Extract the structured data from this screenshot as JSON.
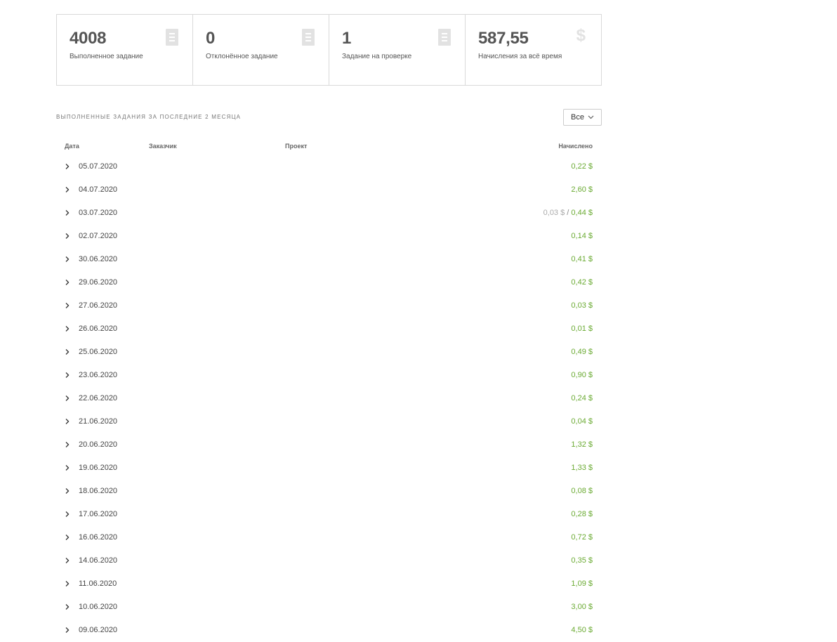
{
  "stats": [
    {
      "value": "4008",
      "label": "Выполненное задание",
      "icon": "document-icon"
    },
    {
      "value": "0",
      "label": "Отклонённое задание",
      "icon": "document-icon"
    },
    {
      "value": "1",
      "label": "Задание на проверке",
      "icon": "document-icon"
    },
    {
      "value": "587,55",
      "label": "Начисления за всё время",
      "icon": "dollar-icon"
    }
  ],
  "section_title": "Выполненные задания за последние 2 месяца",
  "filter": {
    "selected": "Все"
  },
  "table": {
    "headers": {
      "date": "Дата",
      "customer": "Заказчик",
      "project": "Проект",
      "amount": "Начислено"
    },
    "rows": [
      {
        "date": "05.07.2020",
        "amount": "0,22 $"
      },
      {
        "date": "04.07.2020",
        "amount": "2,60 $"
      },
      {
        "date": "03.07.2020",
        "pending": "0,03 $",
        "separator": " / ",
        "amount": "0,44 $"
      },
      {
        "date": "02.07.2020",
        "amount": "0,14 $"
      },
      {
        "date": "30.06.2020",
        "amount": "0,41 $"
      },
      {
        "date": "29.06.2020",
        "amount": "0,42 $"
      },
      {
        "date": "27.06.2020",
        "amount": "0,03 $"
      },
      {
        "date": "26.06.2020",
        "amount": "0,01 $"
      },
      {
        "date": "25.06.2020",
        "amount": "0,49 $"
      },
      {
        "date": "23.06.2020",
        "amount": "0,90 $"
      },
      {
        "date": "22.06.2020",
        "amount": "0,24 $"
      },
      {
        "date": "21.06.2020",
        "amount": "0,04 $"
      },
      {
        "date": "20.06.2020",
        "amount": "1,32 $"
      },
      {
        "date": "19.06.2020",
        "amount": "1,33 $"
      },
      {
        "date": "18.06.2020",
        "amount": "0,08 $"
      },
      {
        "date": "17.06.2020",
        "amount": "0,28 $"
      },
      {
        "date": "16.06.2020",
        "amount": "0,72 $"
      },
      {
        "date": "14.06.2020",
        "amount": "0,35 $"
      },
      {
        "date": "11.06.2020",
        "amount": "1,09 $"
      },
      {
        "date": "10.06.2020",
        "amount": "3,00 $"
      },
      {
        "date": "09.06.2020",
        "amount": "4,50 $"
      }
    ]
  },
  "colors": {
    "amount_green": "#6aaa32",
    "pending_gray": "#aaaaaa",
    "border": "#d9d9d9",
    "icon_gray": "#e2e2e2"
  }
}
